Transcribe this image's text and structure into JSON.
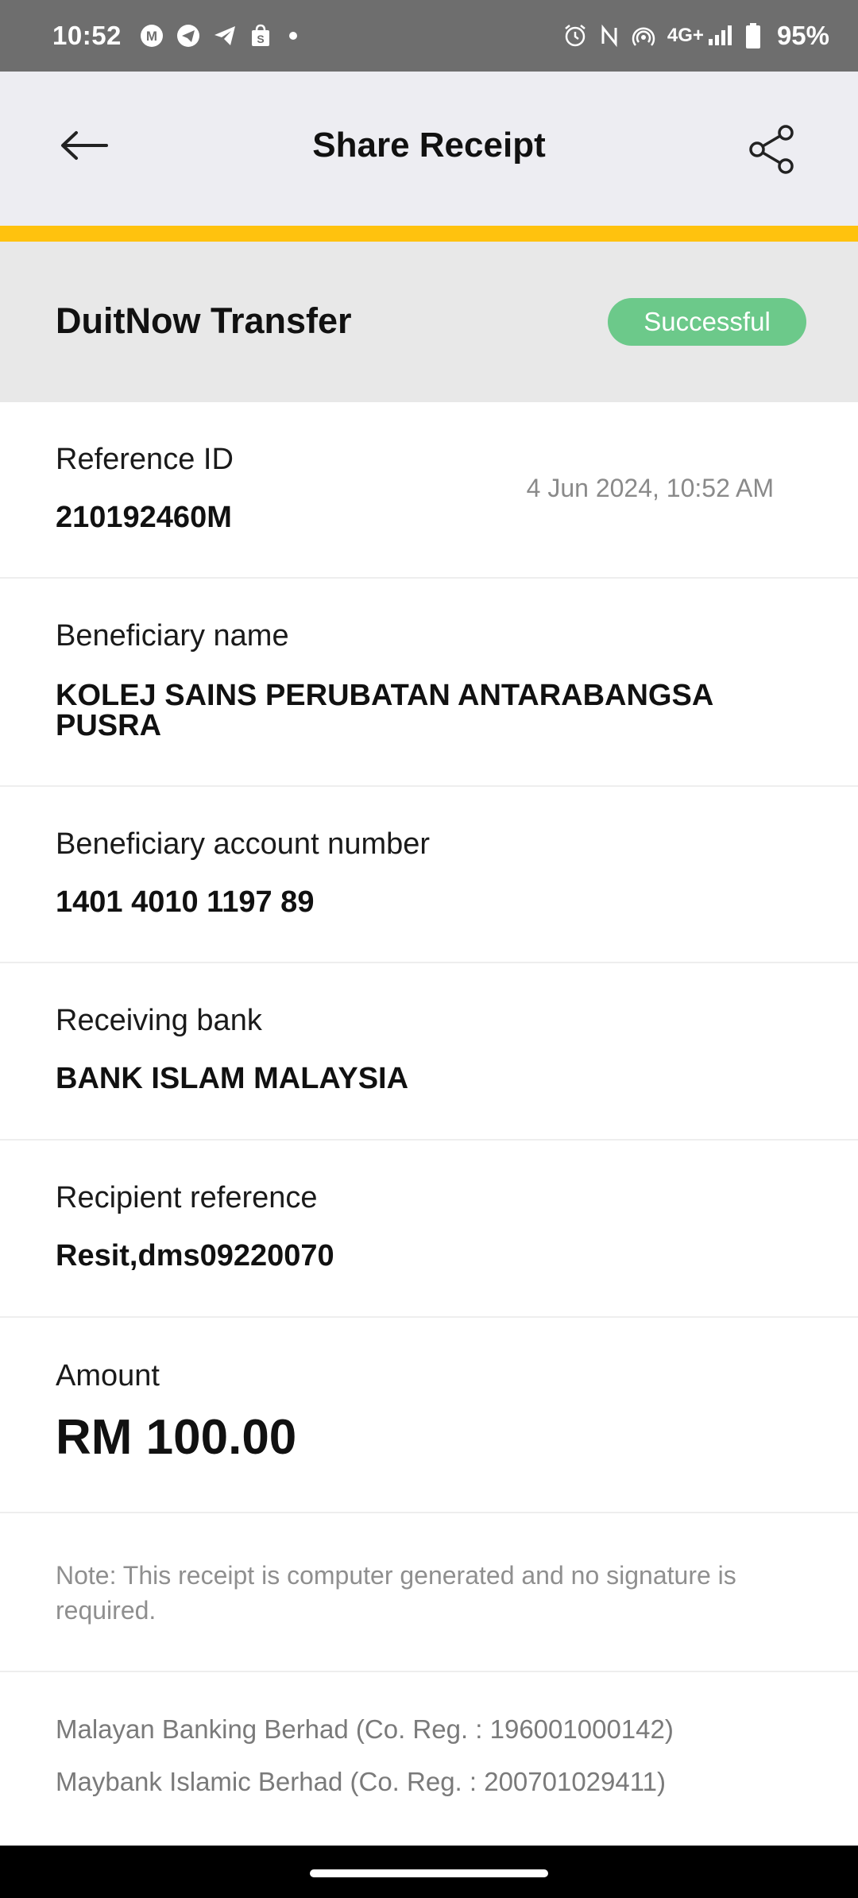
{
  "status_bar": {
    "time": "10:52",
    "network": "4G+",
    "battery": "95%",
    "icons": [
      "m-icon",
      "telegram-icon",
      "telegram-send-icon",
      "shopee-bag-icon",
      "dot-icon",
      "alarm-icon",
      "nfc-icon",
      "hotspot-icon",
      "signal-icon",
      "battery-icon"
    ]
  },
  "app_bar": {
    "title": "Share Receipt",
    "back_icon": "arrow-left-icon",
    "share_icon": "share-icon"
  },
  "colors": {
    "accent_yellow": "#ffc20e",
    "success_green": "#6cc98a",
    "header_bg": "#e8e8e8",
    "appbar_bg": "#ededf2"
  },
  "transaction": {
    "type": "DuitNow Transfer",
    "status": "Successful"
  },
  "details": {
    "reference": {
      "label": "Reference ID",
      "value": "210192460M",
      "datetime": "4 Jun 2024, 10:52 AM"
    },
    "beneficiary_name": {
      "label": "Beneficiary name",
      "value": "KOLEJ SAINS PERUBATAN ANTARABANGSA PUSRA"
    },
    "account_number": {
      "label": "Beneficiary account number",
      "value": "1401 4010 1197 89"
    },
    "receiving_bank": {
      "label": "Receiving bank",
      "value": "BANK ISLAM MALAYSIA"
    },
    "recipient_reference": {
      "label": "Recipient reference",
      "value": "Resit,dms09220070"
    },
    "amount": {
      "label": "Amount",
      "value": "RM 100.00"
    }
  },
  "note": "Note: This receipt is computer generated and no signature is required.",
  "footer": {
    "line1": "Malayan Banking Berhad (Co. Reg. : 196001000142)",
    "line2": "Maybank Islamic Berhad (Co. Reg. : 200701029411)"
  }
}
